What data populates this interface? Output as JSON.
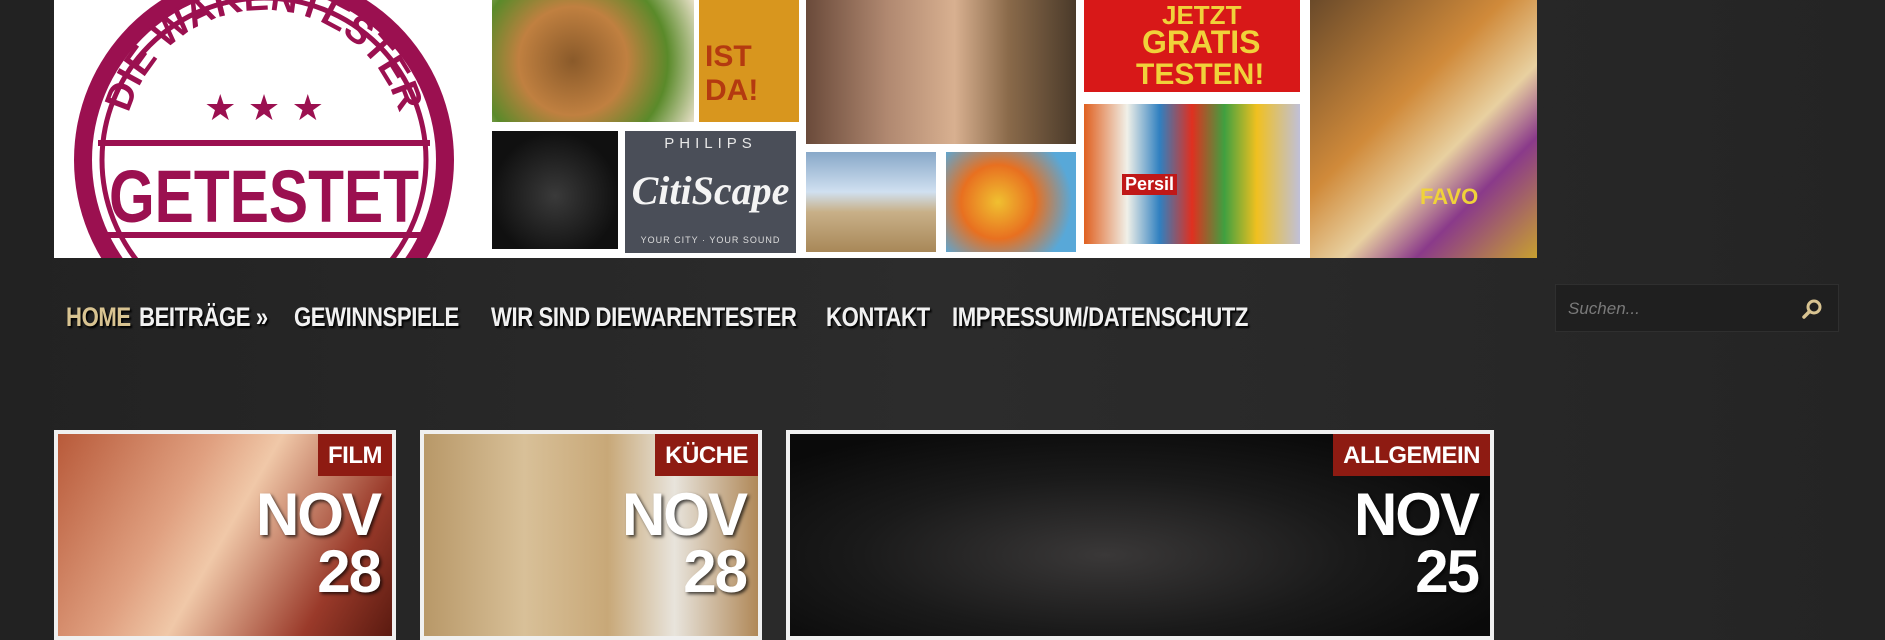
{
  "logo": {
    "arc_text": "DIE WARENTESTER",
    "main_text": "GETESTET",
    "stars": "★ ★ ★"
  },
  "banner_texts": {
    "ist_da": "IST DA!",
    "jetzt": "JETZT",
    "gratis": "GRATIS",
    "testen": "TESTEN!",
    "philips": "PHILIPS",
    "citiscape": "CitiScape",
    "your_city": "YOUR CITY · YOUR SOUND",
    "persil": "Persil",
    "favo": "FAVO"
  },
  "nav": {
    "home": "HOME",
    "beitraege": "BEITRÄGE »",
    "gewinnspiele": "GEWINNSPIELE",
    "wir_sind": "WIR SIND DIEWARENTESTER",
    "kontakt": "KONTAKT",
    "impressum": "IMPRESSUM/DATENSCHUTZ"
  },
  "search": {
    "placeholder": "Suchen...",
    "icon": "search-icon"
  },
  "cards": [
    {
      "category": "FILM",
      "month": "NOV",
      "day": "28"
    },
    {
      "category": "KÜCHE",
      "month": "NOV",
      "day": "28"
    },
    {
      "category": "ALLGEMEIN",
      "month": "NOV",
      "day": "25"
    }
  ],
  "colors": {
    "accent_gold": "#d8c391",
    "category_red": "#8e1b12",
    "logo_magenta": "#9b1050"
  }
}
